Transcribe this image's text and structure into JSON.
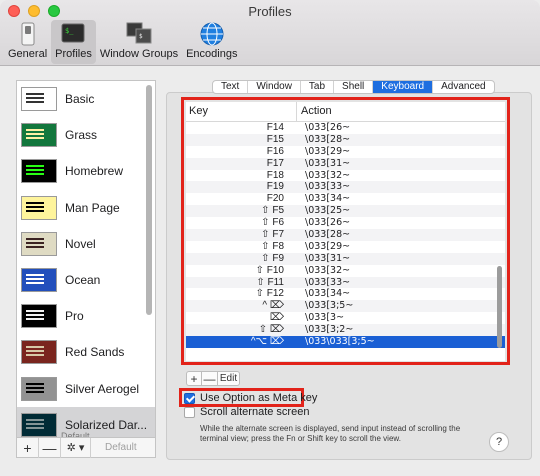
{
  "window": {
    "title": "Profiles"
  },
  "toolbar": {
    "items": [
      {
        "label": "General",
        "icon": "switch-icon"
      },
      {
        "label": "Profiles",
        "icon": "terminal-icon",
        "selected": true
      },
      {
        "label": "Window Groups",
        "icon": "window-groups-icon"
      },
      {
        "label": "Encodings",
        "icon": "globe-icon"
      }
    ]
  },
  "sidebar": {
    "profiles": [
      {
        "name": "Basic",
        "bg": "#ffffff",
        "tx": "#333333"
      },
      {
        "name": "Grass",
        "bg": "#13773d",
        "tx": "#fff0a5"
      },
      {
        "name": "Homebrew",
        "bg": "#000000",
        "tx": "#28fe14"
      },
      {
        "name": "Man Page",
        "bg": "#fef49c",
        "tx": "#000000"
      },
      {
        "name": "Novel",
        "bg": "#dfdbc3",
        "tx": "#3b2322"
      },
      {
        "name": "Ocean",
        "bg": "#224fbc",
        "tx": "#ffffff"
      },
      {
        "name": "Pro",
        "bg": "#000000",
        "tx": "#f2f2f2"
      },
      {
        "name": "Red Sands",
        "bg": "#7a251e",
        "tx": "#d7c9a7"
      },
      {
        "name": "Silver Aerogel",
        "bg": "#929292",
        "tx": "#000000"
      },
      {
        "name": "Solarized Dar...",
        "bg": "#002b36",
        "tx": "#839496",
        "selected": true,
        "tag": "Default"
      }
    ],
    "footer": {
      "add": "+",
      "remove": "—",
      "gear": "✲ ▾",
      "default_label": "Default"
    }
  },
  "tabs": [
    {
      "label": "Text"
    },
    {
      "label": "Window"
    },
    {
      "label": "Tab"
    },
    {
      "label": "Shell"
    },
    {
      "label": "Keyboard",
      "active": true
    },
    {
      "label": "Advanced"
    }
  ],
  "keytable": {
    "headers": {
      "key": "Key",
      "action": "Action"
    },
    "rows": [
      {
        "key": "F14",
        "action": "\\033[26~"
      },
      {
        "key": "F15",
        "action": "\\033[28~"
      },
      {
        "key": "F16",
        "action": "\\033[29~"
      },
      {
        "key": "F17",
        "action": "\\033[31~"
      },
      {
        "key": "F18",
        "action": "\\033[32~"
      },
      {
        "key": "F19",
        "action": "\\033[33~"
      },
      {
        "key": "F20",
        "action": "\\033[34~"
      },
      {
        "key": "⇧ F5",
        "action": "\\033[25~"
      },
      {
        "key": "⇧ F6",
        "action": "\\033[26~"
      },
      {
        "key": "⇧ F7",
        "action": "\\033[28~"
      },
      {
        "key": "⇧ F8",
        "action": "\\033[29~"
      },
      {
        "key": "⇧ F9",
        "action": "\\033[31~"
      },
      {
        "key": "⇧ F10",
        "action": "\\033[32~"
      },
      {
        "key": "⇧ F11",
        "action": "\\033[33~"
      },
      {
        "key": "⇧ F12",
        "action": "\\033[34~"
      },
      {
        "key": "^ ⌦",
        "action": "\\033[3;5~"
      },
      {
        "key": "⌦",
        "action": "\\033[3~"
      },
      {
        "key": "⇧ ⌦",
        "action": "\\033[3;2~"
      },
      {
        "key": "^⌥ ⌦",
        "action": "\\033\\033[3;5~",
        "selected": true
      }
    ],
    "add": "+",
    "remove": "—",
    "edit": "Edit"
  },
  "options": {
    "meta_key": {
      "label": "Use Option as Meta key",
      "checked": true
    },
    "scroll_alt": {
      "label": "Scroll alternate screen",
      "checked": false
    },
    "help_text": "While the alternate screen is displayed, send input instead of scrolling the terminal view; press the Fn or Shift key to scroll the view.",
    "help_button": "?"
  }
}
